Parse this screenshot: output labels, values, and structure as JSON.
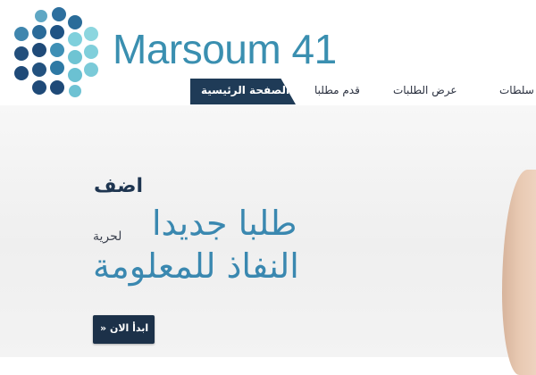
{
  "brand": {
    "name": "Marsoum 41",
    "colors": {
      "light": "#7fd0dc",
      "mid": "#3a8fb0",
      "dark": "#1e4e79"
    }
  },
  "nav": {
    "active_label": "الصفحة الرئيسية",
    "items": [
      {
        "label": "قدم مطلبا"
      },
      {
        "label": "عرض الطلبات"
      },
      {
        "label": "سلطات"
      }
    ]
  },
  "hero": {
    "line1": "اضف",
    "line2": "طلبا جديدا",
    "small": "لحرية",
    "line3": "النفاذ للمعلومة",
    "button_label": "» ابدأ الان"
  },
  "colors": {
    "nav_active_bg": "#1f3b57",
    "headline": "#3a88b0",
    "button_bg": "#1c3149"
  }
}
